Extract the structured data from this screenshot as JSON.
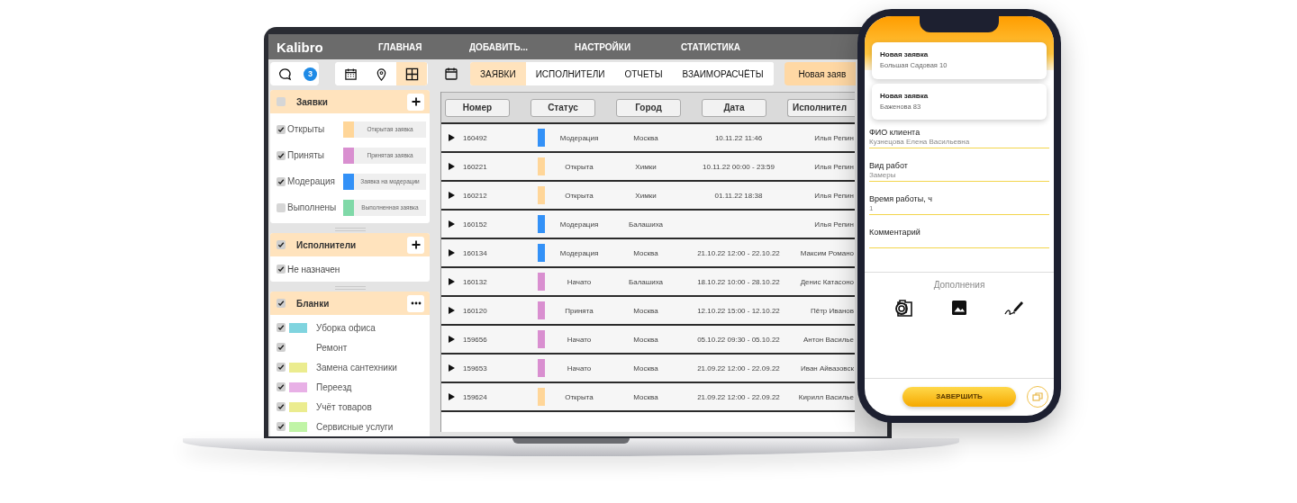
{
  "laptop": {
    "logo": "Kalibro",
    "nav": [
      "ГЛАВНАЯ",
      "ДОБАВИТЬ...",
      "НАСТРОЙКИ",
      "СТАТИСТИКА"
    ],
    "messages_badge": "3",
    "views": [
      {
        "kind": "calendar",
        "selected": false
      },
      {
        "kind": "pin",
        "selected": false
      },
      {
        "kind": "grid",
        "selected": true
      }
    ],
    "tabs": [
      {
        "label": "ЗАЯВКИ",
        "selected": true
      },
      {
        "label": "ИСПОЛНИТЕЛИ",
        "selected": false
      },
      {
        "label": "ОТЧЕТЫ",
        "selected": false
      },
      {
        "label": "ВЗАИМОРАСЧЁТЫ",
        "selected": false
      }
    ],
    "new_button": "Новая заяв",
    "sections": [
      {
        "kind": "statuses",
        "title": "Заявки",
        "checked": false,
        "button": {
          "kind": "add"
        },
        "items": [
          {
            "label": "Открыты",
            "checked": true,
            "color": "#ffd699",
            "legend": "Открытая заявка"
          },
          {
            "label": "Приняты",
            "checked": true,
            "color": "#d98fd0",
            "legend": "Принятая заявка"
          },
          {
            "label": "Модерация",
            "checked": true,
            "color": "#3391f7",
            "legend": "Заявка на модерации"
          },
          {
            "label": "Выполнены",
            "checked": false,
            "color": "#80d9a8",
            "legend": "Выполненная заявка"
          }
        ]
      },
      {
        "kind": "executors",
        "title": "Исполнители",
        "checked": true,
        "button": {
          "kind": "add"
        },
        "items": [
          {
            "label": "Не назначен",
            "checked": true
          }
        ]
      },
      {
        "kind": "forms",
        "title": "Бланки",
        "checked": true,
        "button": {
          "kind": "more"
        },
        "items": [
          {
            "label": "Уборка офиса",
            "checked": true,
            "color": "#80d4df"
          },
          {
            "label": "Ремонт",
            "checked": true
          },
          {
            "label": "Замена сантехники",
            "checked": true,
            "color": "#ebec8f"
          },
          {
            "label": "Переезд",
            "checked": true,
            "color": "#e8b0e6"
          },
          {
            "label": "Учёт товаров",
            "checked": true,
            "color": "#ebec8f"
          },
          {
            "label": "Сервисные услуги",
            "checked": true,
            "color": "#c0f4a6"
          }
        ]
      }
    ],
    "table": {
      "columns": [
        "Номер",
        "Статус",
        "Город",
        "Дата",
        "Исполнител"
      ],
      "rows": [
        {
          "number": "160492",
          "color": "#3391f7",
          "status": "Модерация",
          "city": "Москва",
          "date": "10.11.22 11:46",
          "executor": "Илья Репин"
        },
        {
          "number": "160221",
          "color": "#ffd699",
          "status": "Открыта",
          "city": "Химки",
          "date": "10.11.22 00:00 - 23:59",
          "executor": "Илья Репин"
        },
        {
          "number": "160212",
          "color": "#ffd699",
          "status": "Открыта",
          "city": "Химки",
          "date": "01.11.22 18:38",
          "executor": "Илья Репин"
        },
        {
          "number": "160152",
          "color": "#3391f7",
          "status": "Модерация",
          "city": "Балашиха",
          "executor": "Илья Репин"
        },
        {
          "number": "160134",
          "color": "#3391f7",
          "status": "Модерация",
          "city": "Москва",
          "date": "21.10.22 12:00 - 22.10.22",
          "executor": "Максим Романо"
        },
        {
          "number": "160132",
          "color": "#d98fd0",
          "status": "Начато",
          "city": "Балашиха",
          "date": "18.10.22 10:00 - 28.10.22",
          "executor": "Денис Катасоно"
        },
        {
          "number": "160120",
          "color": "#d98fd0",
          "status": "Принята",
          "city": "Москва",
          "date": "12.10.22 15:00 - 12.10.22",
          "executor": "Пётр Иванов"
        },
        {
          "number": "159656",
          "color": "#d98fd0",
          "status": "Начато",
          "city": "Москва",
          "date": "05.10.22 09:30 - 05.10.22",
          "executor": "Антон Василье"
        },
        {
          "number": "159653",
          "color": "#d98fd0",
          "status": "Начато",
          "city": "Москва",
          "date": "21.09.22 12:00 - 22.09.22",
          "executor": "Иван Айвазовск"
        },
        {
          "number": "159624",
          "color": "#ffd699",
          "status": "Открыта",
          "city": "Москва",
          "date": "21.09.22 12:00 - 22.09.22",
          "executor": "Кирилл Василье"
        }
      ]
    }
  },
  "phone": {
    "notifications": [
      {
        "title": "Новая заявка",
        "text": "Большая Садовая 10"
      },
      {
        "title": "Новая заявка",
        "text": "Баженова 83"
      }
    ],
    "fields": [
      {
        "label": "ФИО клиента",
        "value": "Кузнецова Елена Васильевна"
      },
      {
        "label": "Вид работ",
        "value": "Замеры"
      },
      {
        "label": "Время работы, ч",
        "value": "1"
      },
      {
        "label": "Комментарий"
      }
    ],
    "extras_title": "Дополнения",
    "finish_button": "ЗАВЕРШИТЬ"
  }
}
